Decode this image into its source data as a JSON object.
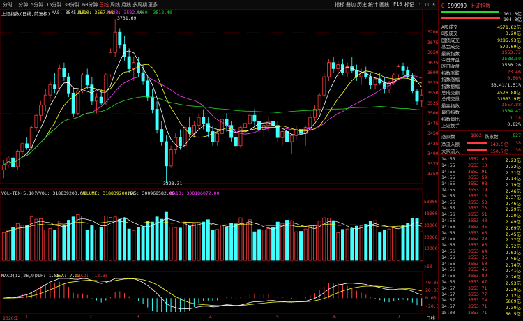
{
  "toolbar": {
    "timeframes": [
      "分时",
      "1分钟",
      "5分钟",
      "15分钟",
      "30分钟",
      "60分钟",
      "日线",
      "周线",
      "月线",
      "多周期",
      "更多"
    ],
    "active_timeframe": "日线",
    "right_items": [
      "指标",
      "叠加",
      "历史",
      "统计",
      "画线",
      "F10",
      "标记",
      "-",
      "□",
      "×"
    ]
  },
  "main_legend": {
    "title": "上证指数(日线,前复权)",
    "ma5": "MA5: 3545.17",
    "ma10": "MA10: 3567.08",
    "ma20": "MA20: 3582.80",
    "ma60": "MA60: 3518.40"
  },
  "annotations": {
    "high": "3731.69",
    "low": "3328.31"
  },
  "vol_legend": {
    "title": "VOL-TDX(5,10)",
    "vvol": "VVOL: 318839200.00",
    "volume": "VOLUME: 318839200.00",
    "ma5": "MA5: 300968582.00",
    "ma10": "MA10: 308186072.00",
    "scale_note": "×10"
  },
  "macd_legend": {
    "title": "MACD(12,26,9)",
    "dif": "DIF: 1.05",
    "dea": "DEA: 7.23",
    "macd": "MACD: -12.35"
  },
  "price_axis": [
    "3700",
    "3675",
    "3650",
    "3625",
    "3600",
    "3575",
    "3550",
    "3525",
    "3500",
    "3475",
    "3450",
    "3425",
    "3400",
    "3375",
    "3350"
  ],
  "vol_axis": [
    "50000",
    "40000",
    "30000",
    "20000",
    "10000"
  ],
  "macd_axis": [
    "40.00",
    "20.00",
    "0.00",
    "-20.00"
  ],
  "date_labels": [
    "2020年",
    "1",
    "2",
    "3",
    "4",
    "5",
    "6",
    "7"
  ],
  "date_corner": "日线",
  "chart_data": {
    "type": "candlestick",
    "candles": [
      [
        3360,
        3385,
        3340,
        3372
      ],
      [
        3372,
        3395,
        3365,
        3390
      ],
      [
        3390,
        3400,
        3360,
        3368
      ],
      [
        3368,
        3410,
        3360,
        3405
      ],
      [
        3405,
        3430,
        3398,
        3425
      ],
      [
        3425,
        3440,
        3410,
        3415
      ],
      [
        3415,
        3470,
        3410,
        3465
      ],
      [
        3465,
        3500,
        3455,
        3495
      ],
      [
        3495,
        3530,
        3480,
        3520
      ],
      [
        3520,
        3560,
        3505,
        3545
      ],
      [
        3545,
        3580,
        3530,
        3570
      ],
      [
        3570,
        3600,
        3550,
        3560
      ],
      [
        3560,
        3620,
        3555,
        3610
      ],
      [
        3610,
        3625,
        3580,
        3590
      ],
      [
        3590,
        3600,
        3540,
        3550
      ],
      [
        3550,
        3565,
        3490,
        3500
      ],
      [
        3500,
        3560,
        3495,
        3555
      ],
      [
        3555,
        3600,
        3550,
        3595
      ],
      [
        3595,
        3610,
        3560,
        3570
      ],
      [
        3570,
        3590,
        3520,
        3530
      ],
      [
        3530,
        3550,
        3500,
        3540
      ],
      [
        3540,
        3560,
        3520,
        3525
      ],
      [
        3525,
        3600,
        3520,
        3595
      ],
      [
        3595,
        3660,
        3590,
        3650
      ],
      [
        3650,
        3732,
        3640,
        3700
      ],
      [
        3700,
        3710,
        3660,
        3670
      ],
      [
        3670,
        3690,
        3630,
        3640
      ],
      [
        3640,
        3660,
        3600,
        3610
      ],
      [
        3610,
        3640,
        3580,
        3625
      ],
      [
        3625,
        3640,
        3590,
        3600
      ],
      [
        3600,
        3620,
        3570,
        3580
      ],
      [
        3580,
        3590,
        3530,
        3540
      ],
      [
        3540,
        3560,
        3500,
        3510
      ],
      [
        3510,
        3530,
        3450,
        3460
      ],
      [
        3460,
        3480,
        3420,
        3430
      ],
      [
        3430,
        3445,
        3328,
        3370
      ],
      [
        3370,
        3420,
        3365,
        3410
      ],
      [
        3410,
        3450,
        3400,
        3440
      ],
      [
        3440,
        3460,
        3410,
        3420
      ],
      [
        3420,
        3470,
        3415,
        3465
      ],
      [
        3465,
        3490,
        3440,
        3450
      ],
      [
        3450,
        3480,
        3440,
        3470
      ],
      [
        3470,
        3500,
        3460,
        3490
      ],
      [
        3490,
        3510,
        3460,
        3475
      ],
      [
        3475,
        3490,
        3440,
        3455
      ],
      [
        3455,
        3470,
        3420,
        3430
      ],
      [
        3430,
        3460,
        3420,
        3450
      ],
      [
        3450,
        3490,
        3445,
        3485
      ],
      [
        3485,
        3500,
        3455,
        3470
      ],
      [
        3470,
        3480,
        3430,
        3440
      ],
      [
        3440,
        3450,
        3410,
        3420
      ],
      [
        3420,
        3470,
        3415,
        3465
      ],
      [
        3465,
        3490,
        3455,
        3475
      ],
      [
        3475,
        3500,
        3465,
        3495
      ],
      [
        3495,
        3510,
        3470,
        3480
      ],
      [
        3480,
        3490,
        3450,
        3460
      ],
      [
        3460,
        3475,
        3440,
        3470
      ],
      [
        3470,
        3490,
        3455,
        3480
      ],
      [
        3480,
        3500,
        3465,
        3470
      ],
      [
        3470,
        3480,
        3430,
        3440
      ],
      [
        3440,
        3460,
        3420,
        3455
      ],
      [
        3455,
        3465,
        3425,
        3430
      ],
      [
        3430,
        3450,
        3400,
        3445
      ],
      [
        3445,
        3470,
        3435,
        3460
      ],
      [
        3460,
        3480,
        3440,
        3450
      ],
      [
        3450,
        3470,
        3420,
        3465
      ],
      [
        3465,
        3500,
        3455,
        3490
      ],
      [
        3490,
        3520,
        3480,
        3510
      ],
      [
        3510,
        3550,
        3500,
        3545
      ],
      [
        3545,
        3600,
        3540,
        3590
      ],
      [
        3590,
        3635,
        3580,
        3625
      ],
      [
        3625,
        3640,
        3600,
        3610
      ],
      [
        3610,
        3630,
        3590,
        3620
      ],
      [
        3620,
        3635,
        3595,
        3600
      ],
      [
        3600,
        3625,
        3590,
        3615
      ],
      [
        3615,
        3640,
        3600,
        3605
      ],
      [
        3605,
        3620,
        3580,
        3590
      ],
      [
        3590,
        3610,
        3570,
        3600
      ],
      [
        3600,
        3615,
        3585,
        3590
      ],
      [
        3590,
        3600,
        3560,
        3570
      ],
      [
        3570,
        3590,
        3560,
        3585
      ],
      [
        3585,
        3600,
        3570,
        3575
      ],
      [
        3575,
        3590,
        3550,
        3560
      ],
      [
        3560,
        3580,
        3550,
        3575
      ],
      [
        3575,
        3600,
        3570,
        3595
      ],
      [
        3595,
        3620,
        3585,
        3615
      ],
      [
        3615,
        3625,
        3595,
        3605
      ],
      [
        3605,
        3615,
        3585,
        3590
      ],
      [
        3590,
        3600,
        3550,
        3555
      ],
      [
        3555,
        3560,
        3520,
        3530
      ],
      [
        3530,
        3560,
        3515,
        3545
      ]
    ],
    "ylim": [
      3330,
      3740
    ],
    "vol_ylim": [
      0,
      55000
    ],
    "macd_ylim": [
      -35,
      50
    ]
  },
  "quote": {
    "code": "999999",
    "name": "上证指数",
    "ratio_top": "101.0亿",
    "ratio_bottom": "104.0亿",
    "rows": [
      {
        "k": "A股成交",
        "v": "4571.82亿",
        "c": "yel"
      },
      {
        "k": "B股成交",
        "v": "3.20亿",
        "c": "yel"
      },
      {
        "k": "国债成交",
        "v": "9285.93亿",
        "c": "yel"
      },
      {
        "k": "基金成交",
        "v": "579.69亿",
        "c": "yel"
      },
      {
        "k": "最新指数",
        "v": "3553.72",
        "c": "red"
      },
      {
        "k": "今日开盘",
        "v": "3588.59",
        "c": "grn"
      },
      {
        "k": "昨日收盘",
        "v": "3530.26",
        "c": "wht"
      },
      {
        "k": "指数涨跌",
        "v": "23.46",
        "c": "red"
      },
      {
        "k": "指数涨幅",
        "v": "0.66%",
        "c": "red"
      },
      {
        "k": "指数振幅",
        "v": "53.41/1.51%",
        "c": "wht"
      },
      {
        "k": "总成交额",
        "v": "4576.88亿",
        "c": "yel"
      },
      {
        "k": "总成交量",
        "v": "31883.9万",
        "c": "yel"
      },
      {
        "k": "最高指数",
        "v": "3557.88",
        "c": "red"
      },
      {
        "k": "最低指数",
        "v": "3504.47",
        "c": "grn"
      },
      {
        "k": "指数量比",
        "v": "1.18",
        "c": "red"
      },
      {
        "k": "上证换手",
        "v": "0.82%",
        "c": "wht"
      }
    ],
    "updown": {
      "up_label": "涨家数",
      "up": "1862",
      "down_label": "跌家数",
      "down": "827"
    },
    "flows": [
      {
        "k": "净流入额",
        "v": "143.5亿",
        "p": "3%"
      },
      {
        "k": "大宗流入",
        "v": "150.7亿",
        "p": "3%"
      }
    ],
    "ticks": [
      {
        "t": "14:55",
        "p": "3552.80",
        "q": "2.23亿",
        "c": "red"
      },
      {
        "t": "14:55",
        "p": "3553.13",
        "q": "2.32亿",
        "c": "red"
      },
      {
        "t": "14:55",
        "p": "3552.91",
        "q": "2.31亿",
        "c": "red"
      },
      {
        "t": "14:55",
        "p": "3553.59",
        "q": "2.14亿",
        "c": "red"
      },
      {
        "t": "14:55",
        "p": "3552.98",
        "q": "2.19亿",
        "c": "red"
      },
      {
        "t": "14:55",
        "p": "3553.19",
        "q": "2.46亿",
        "c": "red"
      },
      {
        "t": "14:55",
        "p": "3553.18",
        "q": "2.37亿",
        "c": "red"
      },
      {
        "t": "14:55",
        "p": "3553.53",
        "q": "2.46亿",
        "c": "red"
      },
      {
        "t": "14:55",
        "p": "3553.73",
        "q": "2.29亿",
        "c": "red"
      },
      {
        "t": "14:56",
        "p": "3553.51",
        "q": "2.20亿",
        "c": "red"
      },
      {
        "t": "14:56",
        "p": "3553.40",
        "q": "2.49亿",
        "c": "red"
      },
      {
        "t": "14:56",
        "p": "3553.45",
        "q": "2.69亿",
        "c": "red"
      },
      {
        "t": "14:56",
        "p": "3553.06",
        "q": "2.45亿",
        "c": "red"
      },
      {
        "t": "14:56",
        "p": "3553.38",
        "q": "2.37亿",
        "c": "red"
      },
      {
        "t": "14:56",
        "p": "3553.65",
        "q": "2.72亿",
        "c": "red"
      },
      {
        "t": "14:56",
        "p": "3553.64",
        "q": "2.63亿",
        "c": "red"
      },
      {
        "t": "14:56",
        "p": "3553.35",
        "q": "2.56亿",
        "c": "red"
      },
      {
        "t": "14:56",
        "p": "3553.50",
        "q": "2.74亿",
        "c": "red"
      },
      {
        "t": "14:56",
        "p": "3553.46",
        "q": "2.41亿",
        "c": "red"
      },
      {
        "t": "14:56",
        "p": "3553.89",
        "q": "2.26亿",
        "c": "red"
      },
      {
        "t": "14:56",
        "p": "3553.67",
        "q": "2.93亿",
        "c": "red"
      },
      {
        "t": "14:57",
        "p": "3553.71",
        "q": "2.29亿",
        "c": "red"
      },
      {
        "t": "14:57",
        "p": "3553.77",
        "q": "2.12亿",
        "c": "red"
      },
      {
        "t": "14:57",
        "p": "3553.74",
        "q": "5809亿",
        "c": "red"
      },
      {
        "t": "14:57",
        "p": "3553.71",
        "q": "2.30亿",
        "c": "red"
      },
      {
        "t": "15:00",
        "p": "3553.71",
        "q": "50.5亿",
        "c": "red"
      }
    ]
  },
  "colors": {
    "up": "#ff3c3c",
    "down": "#40ffff",
    "ma5": "#ffffff",
    "ma10": "#ffff30",
    "ma20": "#ff40ff",
    "ma60": "#27d927",
    "grid": "#6a0000"
  }
}
